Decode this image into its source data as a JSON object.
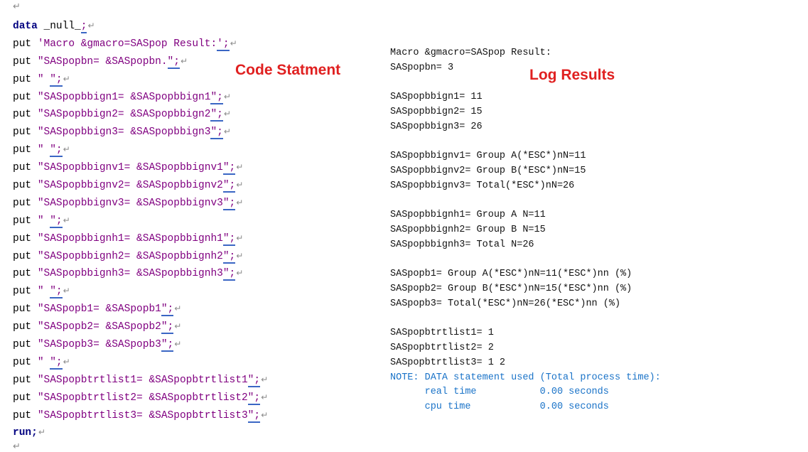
{
  "paragraph_mark": "↵",
  "headings": {
    "code": "Code Statment",
    "log": "Log Results"
  },
  "code_lines": [
    {
      "kw": "data",
      "text": " _null_",
      "tail": ";"
    },
    {
      "kw": "",
      "text": "put ",
      "str": "'Macro &gmacro=SASpop Result:",
      "tail": "';"
    },
    {
      "kw": "",
      "text": "put ",
      "str": "\"SASpopbn= &SASpopbn.",
      "tail": "\";"
    },
    {
      "kw": "",
      "text": "put ",
      "str": "\" ",
      "tail": "\";"
    },
    {
      "kw": "",
      "text": "put ",
      "str": "\"SASpopbbign1= &SASpopbbign1",
      "tail": "\";"
    },
    {
      "kw": "",
      "text": "put ",
      "str": "\"SASpopbbign2= &SASpopbbign2",
      "tail": "\";"
    },
    {
      "kw": "",
      "text": "put ",
      "str": "\"SASpopbbign3= &SASpopbbign3",
      "tail": "\";"
    },
    {
      "kw": "",
      "text": "put ",
      "str": "\" ",
      "tail": "\";"
    },
    {
      "kw": "",
      "text": "put ",
      "str": "\"SASpopbbignv1= &SASpopbbignv1",
      "tail": "\";"
    },
    {
      "kw": "",
      "text": "put ",
      "str": "\"SASpopbbignv2= &SASpopbbignv2",
      "tail": "\";"
    },
    {
      "kw": "",
      "text": "put ",
      "str": "\"SASpopbbignv3= &SASpopbbignv3",
      "tail": "\";"
    },
    {
      "kw": "",
      "text": "put ",
      "str": "\" ",
      "tail": "\";"
    },
    {
      "kw": "",
      "text": "put ",
      "str": "\"SASpopbbignh1= &SASpopbbignh1",
      "tail": "\";"
    },
    {
      "kw": "",
      "text": "put ",
      "str": "\"SASpopbbignh2= &SASpopbbignh2",
      "tail": "\";"
    },
    {
      "kw": "",
      "text": "put ",
      "str": "\"SASpopbbignh3= &SASpopbbignh3",
      "tail": "\";"
    },
    {
      "kw": "",
      "text": "put ",
      "str": "\" ",
      "tail": "\";"
    },
    {
      "kw": "",
      "text": "put ",
      "str": "\"SASpopb1= &SASpopb1",
      "tail": "\";"
    },
    {
      "kw": "",
      "text": "put ",
      "str": "\"SASpopb2= &SASpopb2",
      "tail": "\";"
    },
    {
      "kw": "",
      "text": "put ",
      "str": "\"SASpopb3= &SASpopb3",
      "tail": "\";"
    },
    {
      "kw": "",
      "text": "put ",
      "str": "\" ",
      "tail": "\";"
    },
    {
      "kw": "",
      "text": "put ",
      "str": "\"SASpopbtrtlist1= &SASpopbtrtlist1",
      "tail": "\";"
    },
    {
      "kw": "",
      "text": "put ",
      "str": "\"SASpopbtrtlist2= &SASpopbtrtlist2",
      "tail": "\";"
    },
    {
      "kw": "",
      "text": "put ",
      "str": "\"SASpopbtrtlist3= &SASpopbtrtlist3",
      "tail": "\";"
    },
    {
      "kw": "run;",
      "text": "",
      "tail": ""
    }
  ],
  "log_lines": [
    {
      "text": "Macro &gmacro=SASpop Result:",
      "note": false
    },
    {
      "text": "SASpopbn= 3",
      "note": false
    },
    {
      "text": "",
      "note": false
    },
    {
      "text": "SASpopbbign1= 11",
      "note": false
    },
    {
      "text": "SASpopbbign2= 15",
      "note": false
    },
    {
      "text": "SASpopbbign3= 26",
      "note": false
    },
    {
      "text": "",
      "note": false
    },
    {
      "text": "SASpopbbignv1= Group A(*ESC*)nN=11",
      "note": false
    },
    {
      "text": "SASpopbbignv2= Group B(*ESC*)nN=15",
      "note": false
    },
    {
      "text": "SASpopbbignv3= Total(*ESC*)nN=26",
      "note": false
    },
    {
      "text": "",
      "note": false
    },
    {
      "text": "SASpopbbignh1= Group A N=11",
      "note": false
    },
    {
      "text": "SASpopbbignh2= Group B N=15",
      "note": false
    },
    {
      "text": "SASpopbbignh3= Total N=26",
      "note": false
    },
    {
      "text": "",
      "note": false
    },
    {
      "text": "SASpopb1= Group A(*ESC*)nN=11(*ESC*)nn (%)",
      "note": false
    },
    {
      "text": "SASpopb2= Group B(*ESC*)nN=15(*ESC*)nn (%)",
      "note": false
    },
    {
      "text": "SASpopb3= Total(*ESC*)nN=26(*ESC*)nn (%)",
      "note": false
    },
    {
      "text": "",
      "note": false
    },
    {
      "text": "SASpopbtrtlist1= 1",
      "note": false
    },
    {
      "text": "SASpopbtrtlist2= 2",
      "note": false
    },
    {
      "text": "SASpopbtrtlist3= 1 2",
      "note": false
    },
    {
      "text": "NOTE: DATA statement used (Total process time):",
      "note": true
    },
    {
      "text": "      real time           0.00 seconds",
      "note": true
    },
    {
      "text": "      cpu time            0.00 seconds",
      "note": true
    }
  ],
  "colors": {
    "keyword": "#000080",
    "string": "#800080",
    "heading": "#e02020",
    "note": "#1a73c8"
  }
}
